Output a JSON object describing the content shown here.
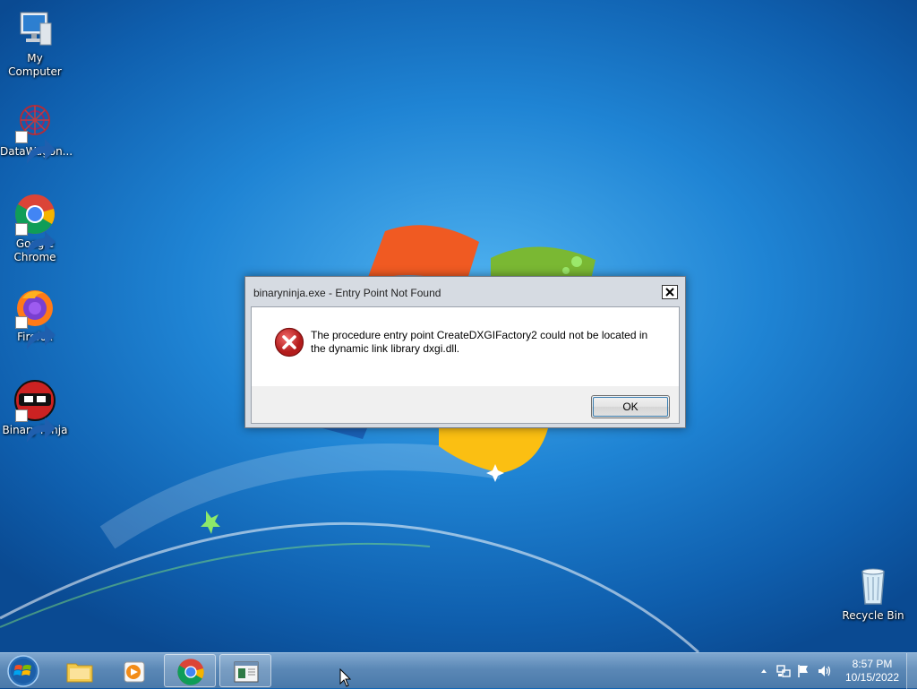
{
  "desktop": {
    "icons": [
      {
        "label": "My Computer",
        "icon": "computer-icon"
      },
      {
        "label": "DataWagon...",
        "icon": "datawagon-icon"
      },
      {
        "label": "Google Chrome",
        "icon": "chrome-icon"
      },
      {
        "label": "Firefox",
        "icon": "firefox-icon"
      },
      {
        "label": "Binary Ninja",
        "icon": "binary-ninja-icon"
      },
      {
        "label": "Recycle Bin",
        "icon": "recycle-bin-icon"
      }
    ]
  },
  "dialog": {
    "title": "binaryninja.exe - Entry Point Not Found",
    "message_line1": "The procedure entry point CreateDXGIFactory2 could not be located in",
    "message_line2": "the dynamic link library dxgi.dll.",
    "ok_label": "OK",
    "icon": "error-icon"
  },
  "taskbar": {
    "buttons": [
      {
        "name": "start-button",
        "icon": "windows-logo-icon"
      },
      {
        "name": "explorer",
        "icon": "folder-icon"
      },
      {
        "name": "media-player",
        "icon": "media-player-icon"
      },
      {
        "name": "chrome",
        "icon": "chrome-icon",
        "active": true
      },
      {
        "name": "window",
        "icon": "window-icon",
        "active": true
      }
    ],
    "clock_time": "8:57 PM",
    "clock_date": "10/15/2022"
  },
  "colors": {
    "desktop_blue": "#1f84d4",
    "error_red": "#d42d2d",
    "taskbar": "#5b88b6"
  }
}
